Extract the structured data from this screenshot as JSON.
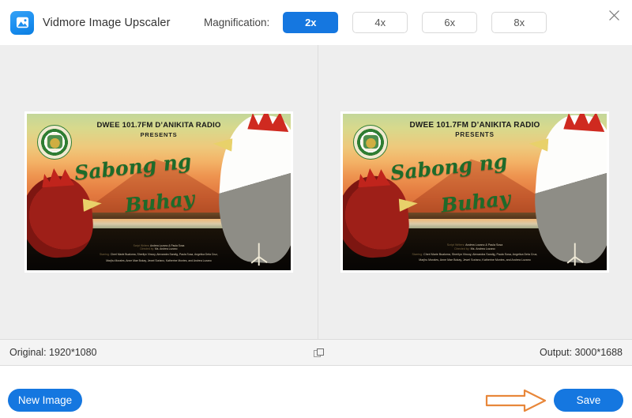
{
  "app": {
    "title": "Vidmore Image Upscaler",
    "logo_icon": "image-photo-icon",
    "close_icon": "close-x-icon"
  },
  "header": {
    "magnification_label": "Magnification:",
    "options": [
      {
        "label": "2x",
        "active": true
      },
      {
        "label": "4x",
        "active": false
      },
      {
        "label": "6x",
        "active": false
      },
      {
        "label": "8x",
        "active": false
      }
    ]
  },
  "preview": {
    "left_pane_name": "original-preview",
    "right_pane_name": "upscaled-preview",
    "poster": {
      "station_line": "DWEE 101.7FM D’ANIKITA RADIO",
      "presents_line": "PRESENTS",
      "title_line_1": "Sabong ng",
      "title_line_2": "Buhay",
      "seal_icon": "school-seal-icon",
      "credits_writers_key": "Script Writers:",
      "credits_writers_value": "Andrea Lozano & Paula Sosa",
      "credits_director_key": "Directed by:",
      "credits_director_value": "Ms. Andrea Lozano",
      "credits_cast_key": "Starring:",
      "credits_cast_line_1": "Cherl Marie Bualoma, Sherilyn Vincoy, Alexandra Sandig, Paula Sosa, Angelica Dela Cruz,",
      "credits_cast_line_2": "Marjhu Morales, Anne Mae Bokay, Jewel Soriano, Katherine Montes, and Andrea Lozano"
    }
  },
  "statusbar": {
    "original_label": "Original: 1920*1080",
    "output_label": "Output: 3000*1688",
    "compare_icon": "compare-overlay-icon"
  },
  "footer": {
    "new_image_label": "New Image",
    "save_label": "Save",
    "annotation_icon": "orange-arrow-pointer"
  },
  "colors": {
    "accent": "#1577e0",
    "annotation": "#E8873A",
    "panel_bg": "#eeeeee",
    "statusbar_bg": "#f4f4f4",
    "poster_title_green": "#1e6b2a"
  }
}
